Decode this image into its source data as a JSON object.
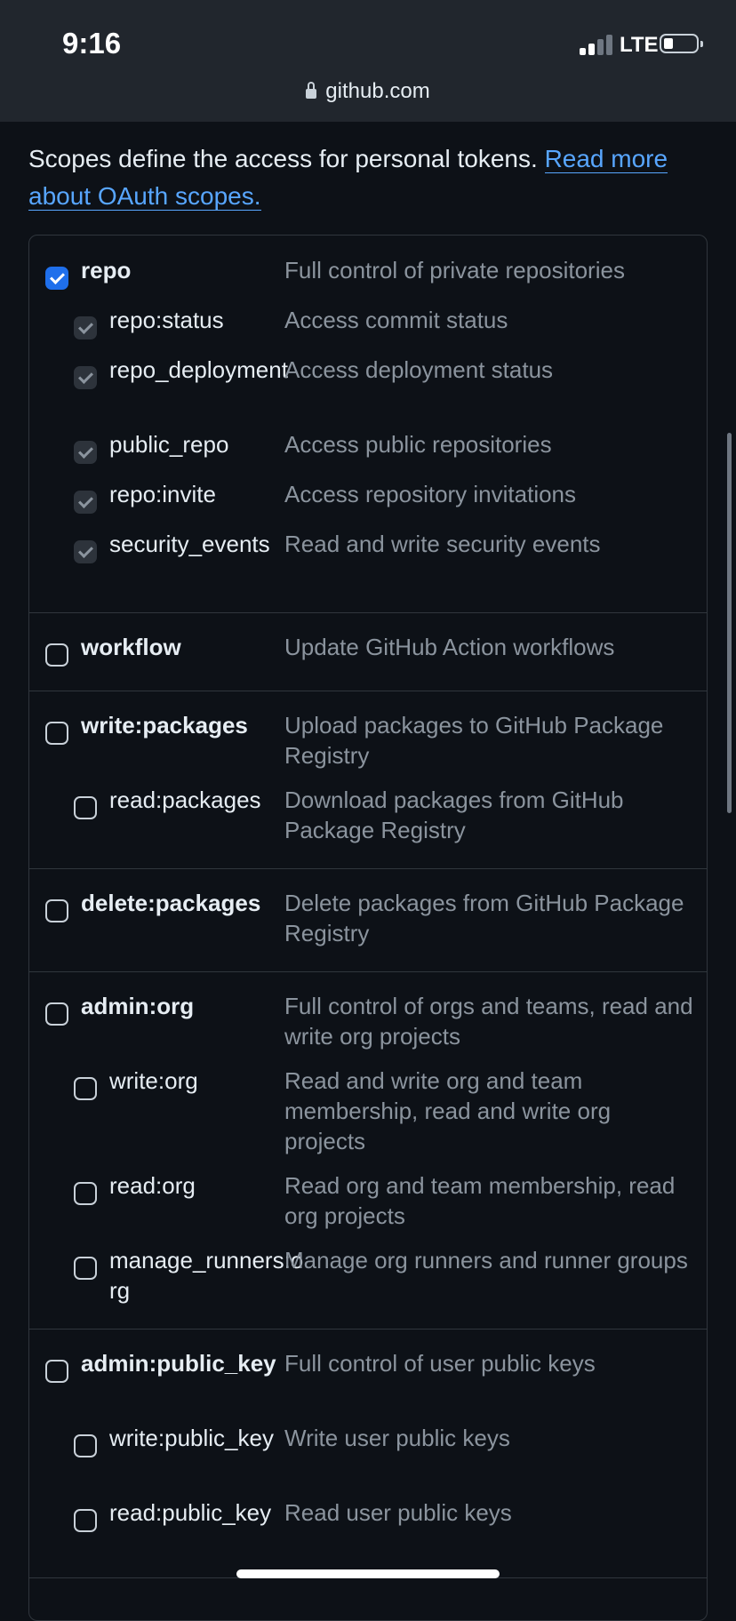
{
  "status_bar": {
    "time": "9:16",
    "network": "LTE"
  },
  "browser": {
    "url": "github.com"
  },
  "intro": {
    "text": "Scopes define the access for personal tokens. ",
    "link_text": "Read more about OAuth scopes."
  },
  "scopes": {
    "repo": {
      "name": "repo",
      "desc": "Full control of private repositories",
      "checked": true
    },
    "repo_status": {
      "name": "repo:status",
      "desc": "Access commit status"
    },
    "repo_deployment": {
      "name": "repo_deployment",
      "desc": "Access deployment status"
    },
    "public_repo": {
      "name": "public_repo",
      "desc": "Access public repositories"
    },
    "repo_invite": {
      "name": "repo:invite",
      "desc": "Access repository invitations"
    },
    "security_events": {
      "name": "security_events",
      "desc": "Read and write security events"
    },
    "workflow": {
      "name": "workflow",
      "desc": "Update GitHub Action workflows"
    },
    "write_packages": {
      "name": "write:packages",
      "desc": "Upload packages to GitHub Package Registry"
    },
    "read_packages": {
      "name": "read:packages",
      "desc": "Download packages from GitHub Package Registry"
    },
    "delete_packages": {
      "name": "delete:packages",
      "desc": "Delete packages from GitHub Package Registry"
    },
    "admin_org": {
      "name": "admin:org",
      "desc": "Full control of orgs and teams, read and write org projects"
    },
    "write_org": {
      "name": "write:org",
      "desc": "Read and write org and team membership, read and write org projects"
    },
    "read_org": {
      "name": "read:org",
      "desc": "Read org and team membership, read org projects"
    },
    "manage_runners_org": {
      "name": "manage_runners:org",
      "desc": "Manage org runners and runner groups"
    },
    "admin_public_key": {
      "name": "admin:public_key",
      "desc": "Full control of user public keys"
    },
    "write_public_key": {
      "name": "write:public_key",
      "desc": "Write user public keys"
    },
    "read_public_key": {
      "name": "read:public_key",
      "desc": "Read user public keys"
    }
  }
}
